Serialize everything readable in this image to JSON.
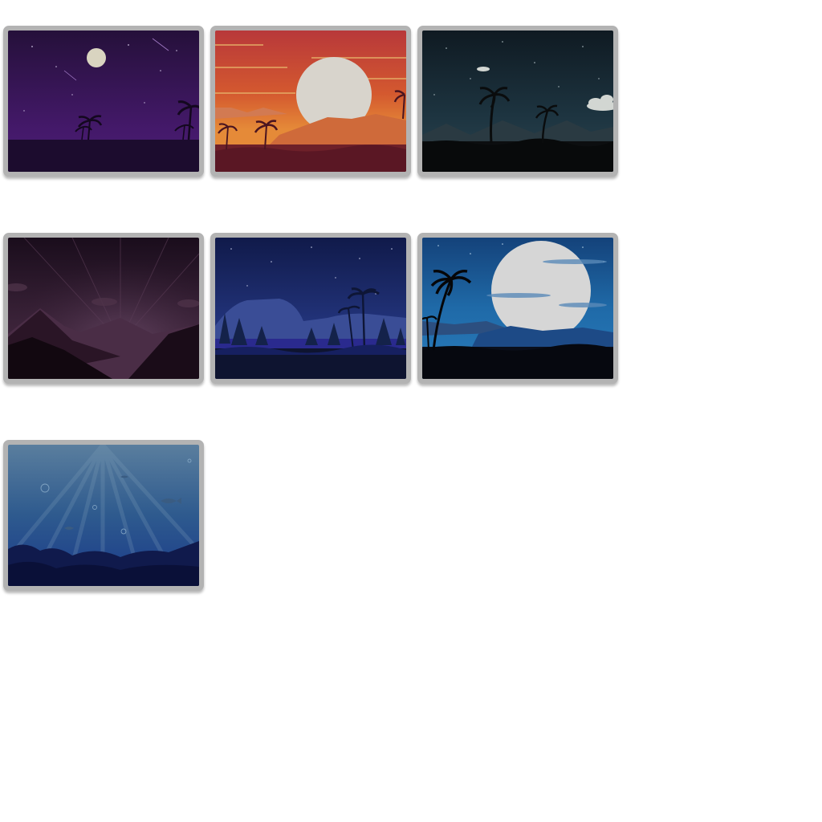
{
  "gallery": {
    "items": [
      {
        "name": "night-purple-palms",
        "icon": "wallpaper-thumbnail"
      },
      {
        "name": "sunset-orange-palms",
        "icon": "wallpaper-thumbnail"
      },
      {
        "name": "night-teal-palms",
        "icon": "wallpaper-thumbnail"
      },
      {
        "name": "purple-mountains",
        "icon": "wallpaper-thumbnail"
      },
      {
        "name": "blue-forest-night",
        "icon": "wallpaper-thumbnail"
      },
      {
        "name": "moon-blue-palms",
        "icon": "wallpaper-thumbnail"
      },
      {
        "name": "underwater-blue",
        "icon": "wallpaper-thumbnail"
      }
    ],
    "colors": {
      "frame": "#b3b3b3",
      "background": "#ffffff"
    }
  }
}
